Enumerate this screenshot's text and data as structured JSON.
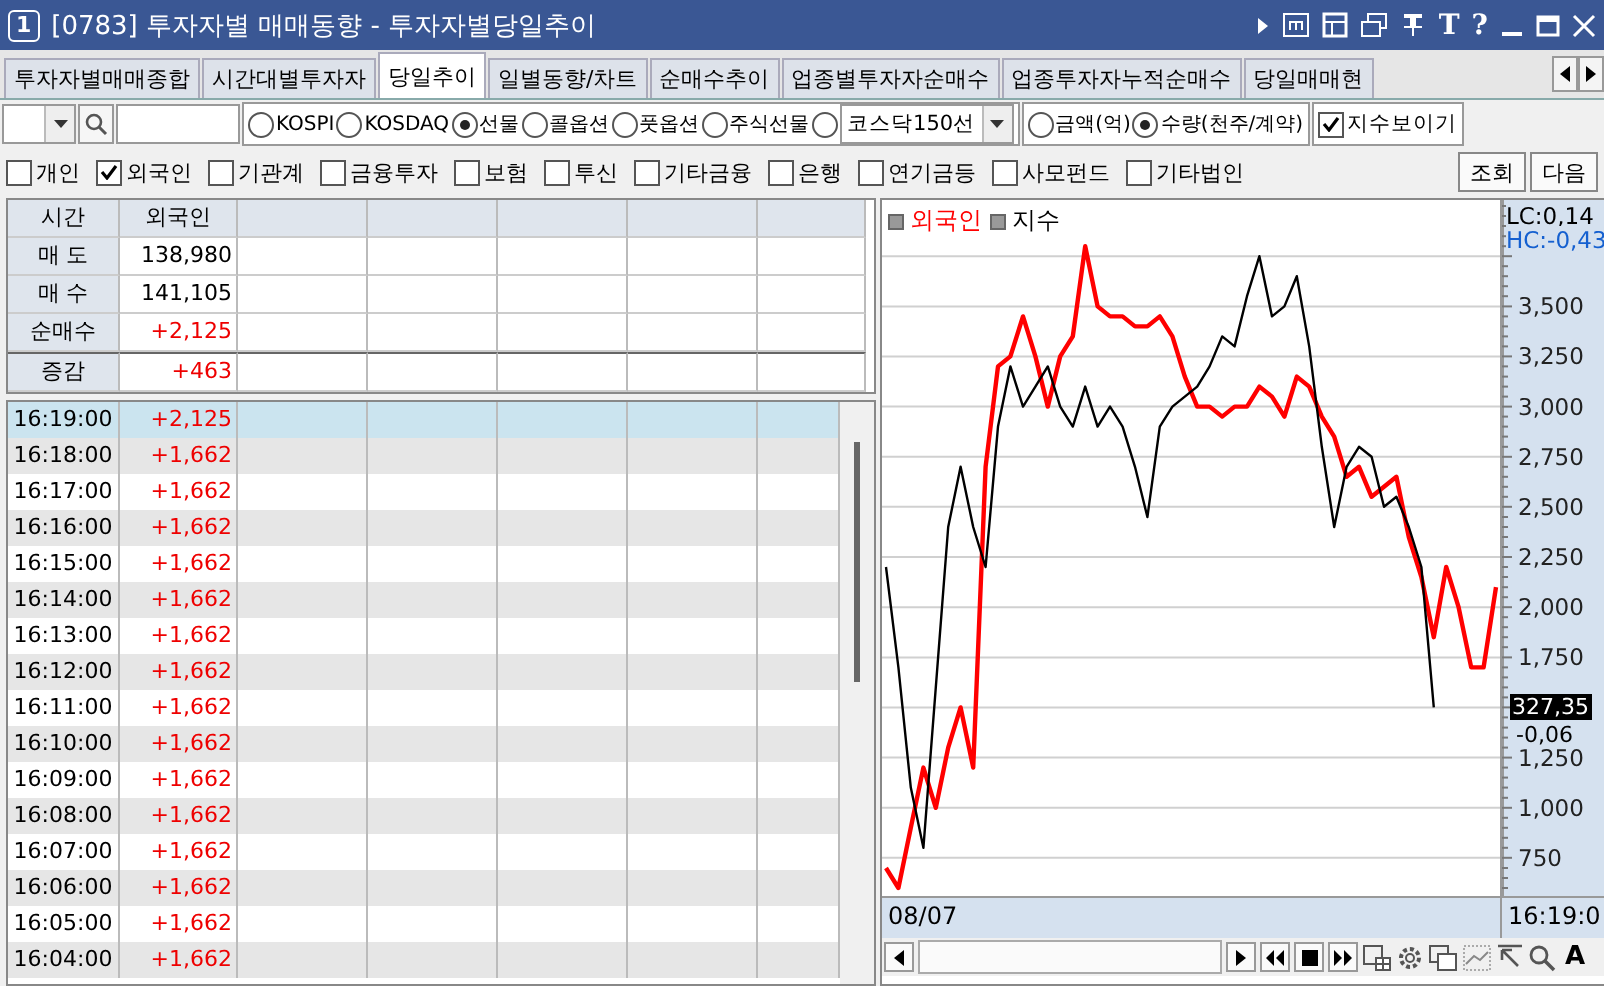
{
  "window": {
    "badge": "1",
    "title": "[0783] 투자자별 매매동향 - 투자자별당일추이",
    "glyph_buttons": [
      "T",
      "?"
    ]
  },
  "tabs": [
    {
      "label": "투자자별매매종합",
      "selected": false
    },
    {
      "label": "시간대별투자자",
      "selected": false
    },
    {
      "label": "당일추이",
      "selected": true
    },
    {
      "label": "일별동향/차트",
      "selected": false
    },
    {
      "label": "순매수추이",
      "selected": false
    },
    {
      "label": "업종별투자자순매수",
      "selected": false
    },
    {
      "label": "업종투자자누적순매수",
      "selected": false
    },
    {
      "label": "당일매매현",
      "selected": false
    }
  ],
  "markets": [
    {
      "label": "KOSPI",
      "selected": false
    },
    {
      "label": "KOSDAQ",
      "selected": false
    },
    {
      "label": "선물",
      "selected": true
    },
    {
      "label": "콜옵션",
      "selected": false
    },
    {
      "label": "풋옵션",
      "selected": false
    },
    {
      "label": "주식선물",
      "selected": false
    }
  ],
  "market_select": {
    "value": "코스닥150선",
    "selected": false
  },
  "units": [
    {
      "label": "금액(억)",
      "selected": false
    },
    {
      "label": "수량(천주/계약)",
      "selected": true
    }
  ],
  "show_index": {
    "label": "지수보이기",
    "checked": true
  },
  "investors": [
    {
      "label": "개인",
      "checked": false
    },
    {
      "label": "외국인",
      "checked": true
    },
    {
      "label": "기관계",
      "checked": false
    },
    {
      "label": "금융투자",
      "checked": false
    },
    {
      "label": "보험",
      "checked": false
    },
    {
      "label": "투신",
      "checked": false
    },
    {
      "label": "기타금융",
      "checked": false
    },
    {
      "label": "은행",
      "checked": false
    },
    {
      "label": "연기금등",
      "checked": false
    },
    {
      "label": "사모펀드",
      "checked": false
    },
    {
      "label": "기타법인",
      "checked": false
    }
  ],
  "buttons": [
    "조회",
    "다음"
  ],
  "summary": {
    "columns": [
      "시간",
      "외국인"
    ],
    "rows": [
      {
        "label": "매 도",
        "value": "138,980",
        "kind": "plain"
      },
      {
        "label": "매 수",
        "value": "141,105",
        "kind": "plain"
      },
      {
        "label": "순매수",
        "value": "+2,125",
        "kind": "up"
      },
      {
        "label": "증감",
        "value": "+463",
        "kind": "up"
      }
    ]
  },
  "timeline": [
    {
      "time": "16:19:00",
      "value": "+2,125",
      "selected": true
    },
    {
      "time": "16:18:00",
      "value": "+1,662",
      "selected": false
    },
    {
      "time": "16:17:00",
      "value": "+1,662",
      "selected": false
    },
    {
      "time": "16:16:00",
      "value": "+1,662",
      "selected": false
    },
    {
      "time": "16:15:00",
      "value": "+1,662",
      "selected": false
    },
    {
      "time": "16:14:00",
      "value": "+1,662",
      "selected": false
    },
    {
      "time": "16:13:00",
      "value": "+1,662",
      "selected": false
    },
    {
      "time": "16:12:00",
      "value": "+1,662",
      "selected": false
    },
    {
      "time": "16:11:00",
      "value": "+1,662",
      "selected": false
    },
    {
      "time": "16:10:00",
      "value": "+1,662",
      "selected": false
    },
    {
      "time": "16:09:00",
      "value": "+1,662",
      "selected": false
    },
    {
      "time": "16:08:00",
      "value": "+1,662",
      "selected": false
    },
    {
      "time": "16:07:00",
      "value": "+1,662",
      "selected": false
    },
    {
      "time": "16:06:00",
      "value": "+1,662",
      "selected": false
    },
    {
      "time": "16:05:00",
      "value": "+1,662",
      "selected": false
    },
    {
      "time": "16:04:00",
      "value": "+1,662",
      "selected": false
    }
  ],
  "chart": {
    "lc": "LC:0,14",
    "hc": "HC:-0,43",
    "last_value": "327,35",
    "last_change": "-0,06",
    "date": "08/07",
    "time": "16:19:0",
    "tool_glyph": "A",
    "chart_data": {
      "type": "line",
      "grid": true,
      "ylim": [
        550,
        4030
      ],
      "yticks": [
        {
          "value": 750,
          "label": "750"
        },
        {
          "value": 1000,
          "label": "1,000"
        },
        {
          "value": 1250,
          "label": "1,250"
        },
        {
          "value": 1750,
          "label": "1,750"
        },
        {
          "value": 2000,
          "label": "2,000"
        },
        {
          "value": 2250,
          "label": "2,250"
        },
        {
          "value": 2500,
          "label": "2,500"
        },
        {
          "value": 2750,
          "label": "2,750"
        },
        {
          "value": 3000,
          "label": "3,000"
        },
        {
          "value": 3250,
          "label": "3,250"
        },
        {
          "value": 3500,
          "label": "3,500"
        }
      ],
      "series": [
        {
          "name": "외국인",
          "color": "#ff0000",
          "values": [
            700,
            600,
            900,
            1200,
            1000,
            1300,
            1500,
            1200,
            2700,
            3200,
            3250,
            3450,
            3250,
            3000,
            3250,
            3350,
            3800,
            3500,
            3450,
            3450,
            3400,
            3400,
            3450,
            3350,
            3150,
            3000,
            3000,
            2950,
            3000,
            3000,
            3100,
            3050,
            2950,
            3150,
            3100,
            2950,
            2850,
            2650,
            2700,
            2550,
            2600,
            2650,
            2350,
            2150,
            1850,
            2200,
            2000,
            1700,
            1700,
            2100
          ]
        },
        {
          "name": "지수",
          "color": "#000000",
          "values": [
            2200,
            1700,
            1100,
            800,
            1600,
            2400,
            2700,
            2400,
            2200,
            2900,
            3200,
            3000,
            3100,
            3200,
            3000,
            2900,
            3100,
            2900,
            3000,
            2900,
            2700,
            2450,
            2900,
            3000,
            3050,
            3100,
            3200,
            3350,
            3300,
            3550,
            3750,
            3450,
            3500,
            3650,
            3300,
            2800,
            2400,
            2700,
            2800,
            2750,
            2500,
            2550,
            2400,
            2200,
            1500,
            null,
            null,
            null,
            null,
            null
          ]
        }
      ]
    }
  }
}
